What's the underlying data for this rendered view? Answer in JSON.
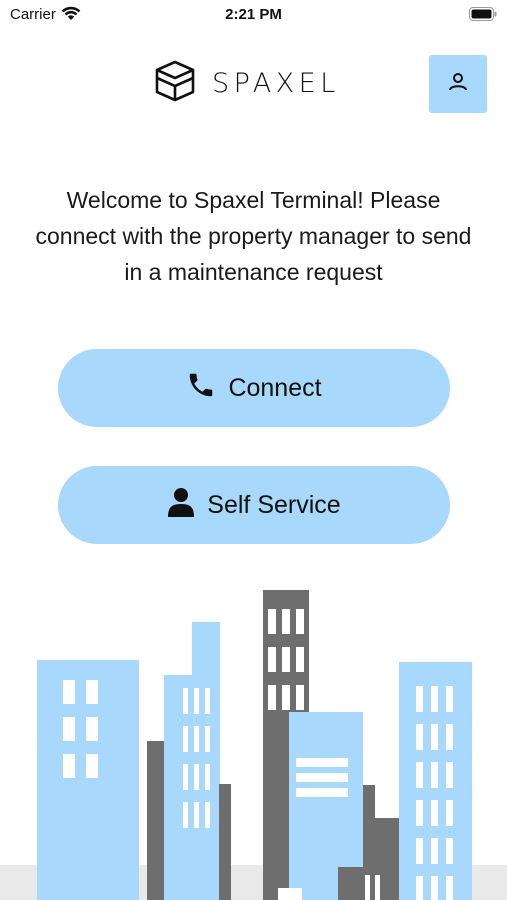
{
  "status_bar": {
    "carrier": "Carrier",
    "time": "2:21 PM"
  },
  "header": {
    "logo_text": "SPAXEL"
  },
  "welcome_text": "Welcome to Spaxel Terminal! Please connect with the property manager to send in a maintenance request",
  "actions": {
    "connect_label": "Connect",
    "self_service_label": "Self Service"
  },
  "colors": {
    "accent": "#a8d8fb",
    "building_dark": "#6e6e6e",
    "ground": "#e9e9e9"
  },
  "icons": {
    "wifi": "wifi-icon",
    "battery": "battery-icon",
    "logo": "spaxel-cube-icon",
    "profile": "profile-icon",
    "phone": "phone-icon",
    "person": "person-icon"
  }
}
